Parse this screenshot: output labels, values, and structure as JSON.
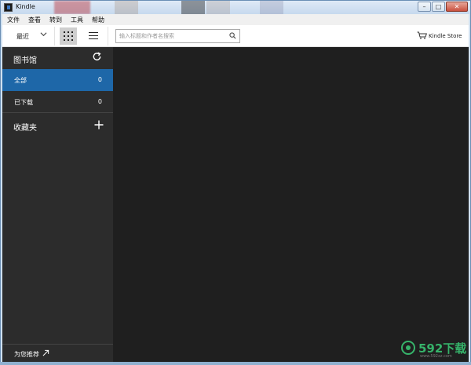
{
  "window": {
    "title": "Kindle",
    "caption": {
      "minimize": "–",
      "maximize": "□",
      "close": "✕"
    }
  },
  "menu": [
    "文件",
    "查看",
    "转到",
    "工具",
    "帮助"
  ],
  "toolbar": {
    "sort_label": "最近",
    "search_placeholder": "输入标题和作者名搜索",
    "store_label": "Kindle Store"
  },
  "sidebar": {
    "library_title": "图书馆",
    "items": [
      {
        "label": "全部",
        "count": "0",
        "active": true
      },
      {
        "label": "已下载",
        "count": "0",
        "active": false
      }
    ],
    "collections_title": "收藏夹",
    "recommend_label": "为您推荐"
  },
  "watermark": {
    "text": "592下载",
    "sub": "www.592xz.com"
  },
  "colors": {
    "accent": "#1e67a8",
    "sidebar": "#2c2c2c",
    "content": "#1f1f1f"
  }
}
